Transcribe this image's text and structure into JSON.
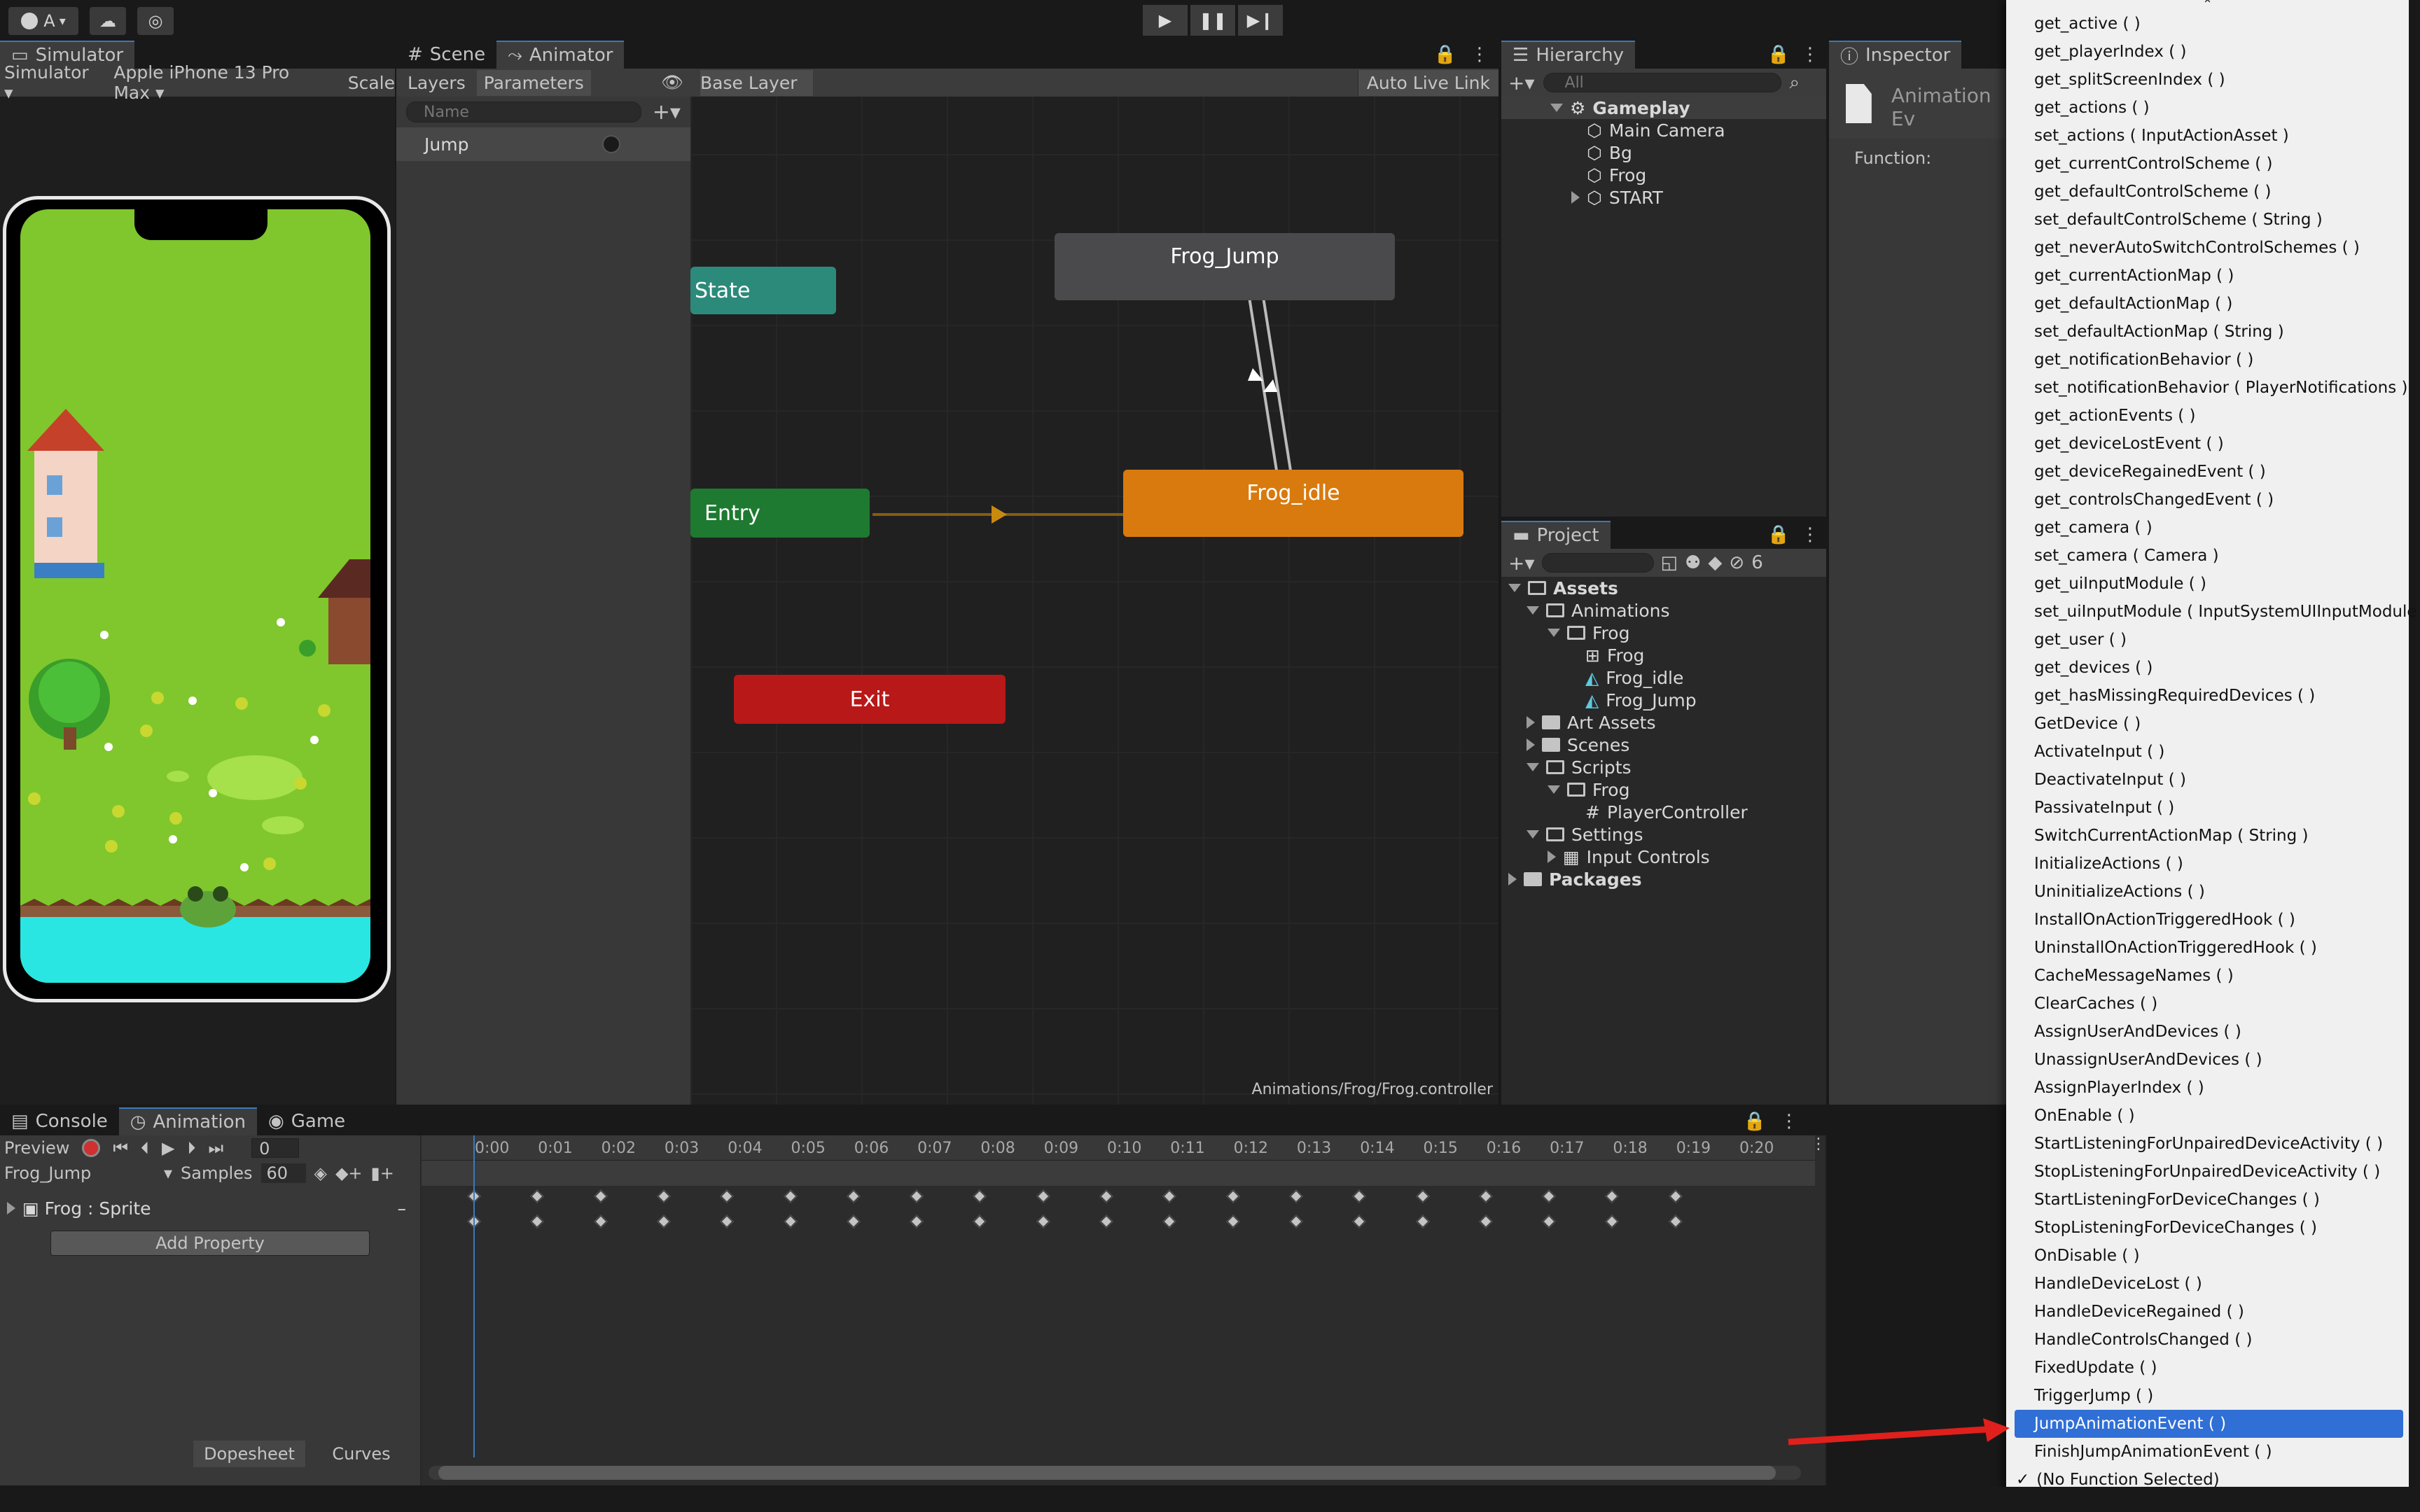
{
  "toolbar": {
    "account": "A",
    "account_caret": "▾"
  },
  "simulator": {
    "tab": "Simulator",
    "device_mode": "Simulator",
    "device": "Apple iPhone 13 Pro Max",
    "scale": "Scale"
  },
  "center_tabs": {
    "scene": "Scene",
    "animator": "Animator"
  },
  "animator": {
    "layers_tab": "Layers",
    "parameters_tab": "Parameters",
    "search_placeholder": "Name",
    "param_name": "Jump",
    "breadcrumb": "Base Layer",
    "auto_live_link": "Auto Live Link",
    "path": "Animations/Frog/Frog.controller",
    "nodes": {
      "state": "State",
      "entry": "Entry",
      "exit": "Exit",
      "frog_jump": "Frog_Jump",
      "frog_idle": "Frog_idle"
    }
  },
  "hierarchy": {
    "tab": "Hierarchy",
    "search_placeholder": "All",
    "scene": "Gameplay",
    "items": [
      "Main Camera",
      "Bg",
      "Frog",
      "START"
    ]
  },
  "project": {
    "tab": "Project",
    "hidden_count": "6",
    "assets": "Assets",
    "animations": "Animations",
    "frog_folder": "Frog",
    "frog_controller": "Frog",
    "frog_idle": "Frog_idle",
    "frog_jump": "Frog_Jump",
    "art_assets": "Art Assets",
    "scenes": "Scenes",
    "scripts": "Scripts",
    "scripts_frog": "Frog",
    "player_controller": "PlayerController",
    "settings": "Settings",
    "input_controls": "Input Controls",
    "packages": "Packages"
  },
  "inspector": {
    "tab": "Inspector",
    "title": "Animation Ev",
    "function_label": "Function:"
  },
  "bottom_tabs": {
    "console": "Console",
    "animation": "Animation",
    "game": "Game"
  },
  "animation": {
    "preview": "Preview",
    "frame": "0",
    "clip": "Frog_Jump",
    "samples_label": "Samples",
    "samples": "60",
    "property": "Frog : Sprite",
    "add_property": "Add Property",
    "dopesheet": "Dopesheet",
    "curves": "Curves",
    "ticks": [
      "0:00",
      "0:01",
      "0:02",
      "0:03",
      "0:04",
      "0:05",
      "0:06",
      "0:07",
      "0:08",
      "0:09",
      "0:10",
      "0:11",
      "0:12",
      "0:13",
      "0:14",
      "0:15",
      "0:16",
      "0:17",
      "0:18",
      "0:19",
      "0:20"
    ]
  },
  "menu": {
    "scroll_up": "⌃",
    "items": [
      "get_active ( )",
      "get_playerIndex ( )",
      "get_splitScreenIndex ( )",
      "get_actions ( )",
      "set_actions ( InputActionAsset )",
      "get_currentControlScheme ( )",
      "get_defaultControlScheme ( )",
      "set_defaultControlScheme ( String )",
      "get_neverAutoSwitchControlSchemes ( )",
      "get_currentActionMap ( )",
      "get_defaultActionMap ( )",
      "set_defaultActionMap ( String )",
      "get_notificationBehavior ( )",
      "set_notificationBehavior ( PlayerNotifications )",
      "get_actionEvents ( )",
      "get_deviceLostEvent ( )",
      "get_deviceRegainedEvent ( )",
      "get_controlsChangedEvent ( )",
      "get_camera ( )",
      "set_camera ( Camera )",
      "get_uiInputModule ( )",
      "set_uiInputModule ( InputSystemUIInputModule )",
      "get_user ( )",
      "get_devices ( )",
      "get_hasMissingRequiredDevices ( )",
      "GetDevice ( )",
      "ActivateInput ( )",
      "DeactivateInput ( )",
      "PassivateInput ( )",
      "SwitchCurrentActionMap ( String )",
      "InitializeActions ( )",
      "UninitializeActions ( )",
      "InstallOnActionTriggeredHook ( )",
      "UninstallOnActionTriggeredHook ( )",
      "CacheMessageNames ( )",
      "ClearCaches ( )",
      "AssignUserAndDevices ( )",
      "UnassignUserAndDevices ( )",
      "AssignPlayerIndex ( )",
      "OnEnable ( )",
      "StartListeningForUnpairedDeviceActivity ( )",
      "StopListeningForUnpairedDeviceActivity ( )",
      "StartListeningForDeviceChanges ( )",
      "StopListeningForDeviceChanges ( )",
      "OnDisable ( )",
      "HandleDeviceLost ( )",
      "HandleDeviceRegained ( )",
      "HandleControlsChanged ( )",
      "FixedUpdate ( )",
      "TriggerJump ( )",
      "JumpAnimationEvent ( )",
      "FinishJumpAnimationEvent ( )"
    ],
    "selected_index": 50,
    "no_function": "(No Function Selected)",
    "check": "✓"
  }
}
